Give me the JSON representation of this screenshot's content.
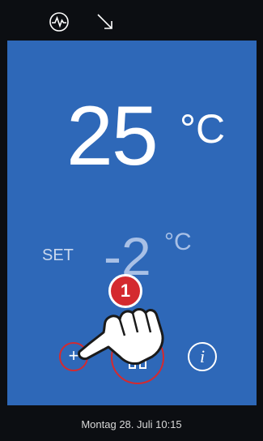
{
  "icons": {
    "status_icon": "waveform-circle-icon",
    "trend_icon": "arrow-down-right-icon"
  },
  "display": {
    "current_temperature": "25",
    "current_unit": "°C",
    "set_label": "SET",
    "set_temperature": "-2",
    "set_unit": "°C"
  },
  "controls": {
    "plus_label": "+",
    "info_label": "i"
  },
  "annotation": {
    "step_number": "1"
  },
  "footer": {
    "datetime": "Montag 28. Juli 10:15"
  },
  "colors": {
    "panel": "#2e68b8",
    "highlight": "#d42a2f",
    "background": "#0c0e12"
  }
}
